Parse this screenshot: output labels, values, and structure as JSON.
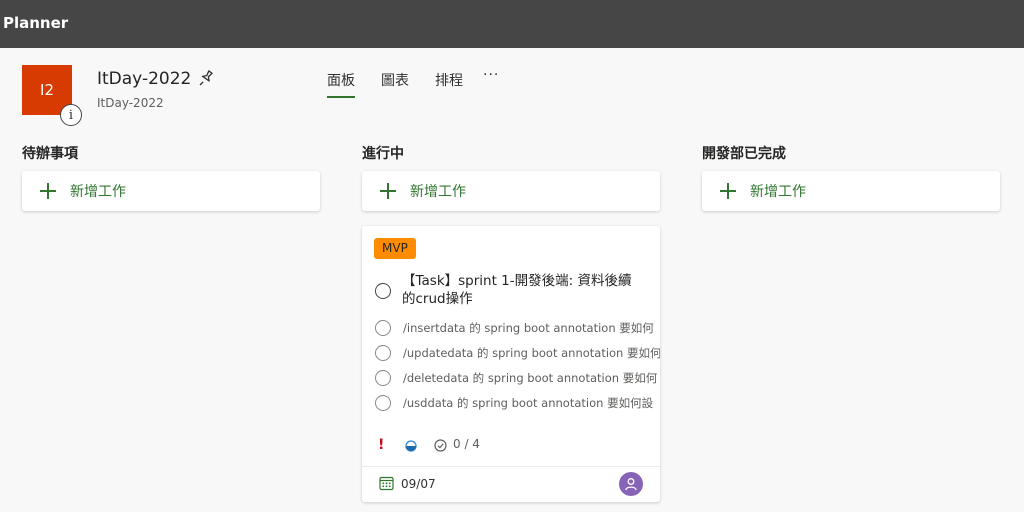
{
  "app": {
    "title": "Planner"
  },
  "plan": {
    "tile_text": "I2",
    "info_glyph": "i",
    "name": "ItDay-2022",
    "group": "ItDay-2022"
  },
  "tabs": [
    {
      "label": "面板"
    },
    {
      "label": "圖表"
    },
    {
      "label": "排程"
    }
  ],
  "more_glyph": "···",
  "buckets": [
    {
      "title": "待辦事項",
      "add_label": "新增工作"
    },
    {
      "title": "進行中",
      "add_label": "新增工作"
    },
    {
      "title": "開發部已完成",
      "add_label": "新增工作"
    }
  ],
  "task": {
    "label": "MVP",
    "title": "【Task】sprint 1-開發後端: 資料後續的crud操作",
    "checklist": [
      "/insertdata 的 spring boot annotation 要如何",
      "/updatedata 的 spring boot annotation 要如何",
      "/deletedata 的 spring boot annotation 要如何",
      "/usddata 的 spring boot annotation 要如何設"
    ],
    "priority_glyph": "!",
    "checklist_count": "0 / 4",
    "due_date": "09/07"
  },
  "colors": {
    "topbar": "#464646",
    "accent": "#31752f",
    "tile": "#d83b01",
    "label": "#ff8c00",
    "avatar": "#8764b8"
  }
}
